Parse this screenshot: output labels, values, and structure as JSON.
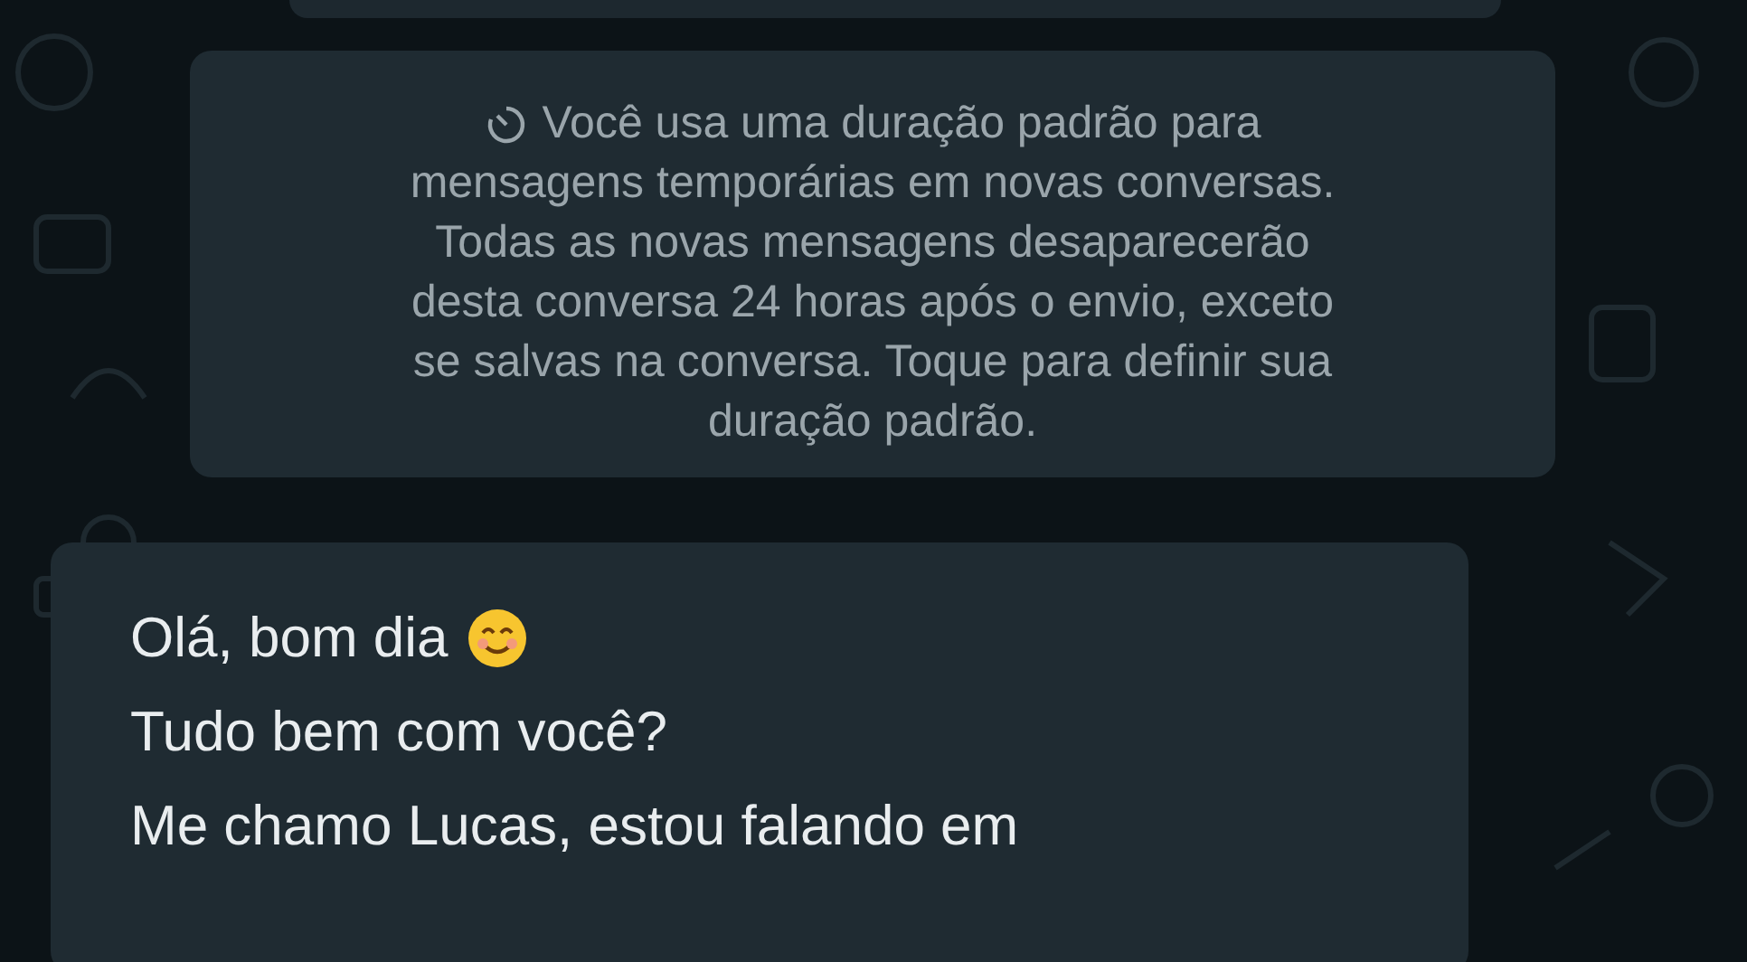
{
  "notice": {
    "lines": [
      "Você usa uma duração padrão para",
      "mensagens temporárias em novas conversas.",
      "Todas as novas mensagens desaparecerão",
      "desta conversa 24 horas após o envio, exceto",
      "se salvas na conversa. Toque para definir sua",
      "duração padrão."
    ]
  },
  "message": {
    "lines": [
      "Olá, bom dia",
      "Tudo bem com você?",
      "Me chamo Lucas, estou falando em"
    ]
  }
}
